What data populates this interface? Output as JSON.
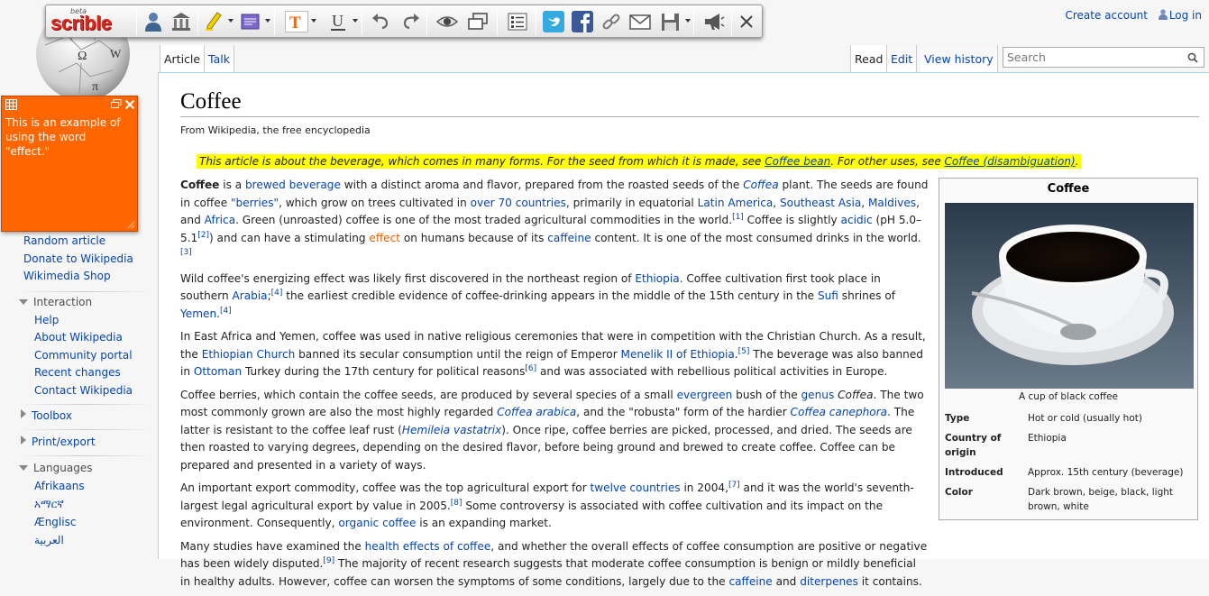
{
  "toolbar": {
    "logo_text": "scrible",
    "logo_badge": "beta",
    "buttons": [
      "my-library",
      "library",
      "highlight",
      "note",
      "text-annotate",
      "underline",
      "undo",
      "redo",
      "view",
      "windows",
      "list",
      "twitter",
      "facebook",
      "link",
      "email",
      "save",
      "announce",
      "close"
    ]
  },
  "note": {
    "text": "This is an example of using the word \"effect.\""
  },
  "personal": {
    "create_account": "Create account",
    "login": "Log in"
  },
  "tabs": {
    "article": "Article",
    "talk": "Talk",
    "read": "Read",
    "edit": "Edit",
    "history": "View history"
  },
  "search": {
    "placeholder": "Search"
  },
  "sidebar": {
    "links_top": [
      "Random article",
      "Donate to Wikipedia",
      "Wikimedia Shop"
    ],
    "interaction": {
      "heading": "Interaction",
      "items": [
        "Help",
        "About Wikipedia",
        "Community portal",
        "Recent changes",
        "Contact Wikipedia"
      ]
    },
    "toolbox": "Toolbox",
    "print_export": "Print/export",
    "languages": {
      "heading": "Languages",
      "items": [
        "Afrikaans",
        "አማርኛ",
        "Ænglisc",
        "العربية"
      ]
    }
  },
  "article": {
    "title": "Coffee",
    "subtitle": "From Wikipedia, the free encyclopedia",
    "hatnote": {
      "pre": "This article is about the beverage, which comes in many forms. For the seed from which it is made, see ",
      "link1": "Coffee bean",
      "mid": ". For other uses, see ",
      "link2": "Coffee (disambiguation)",
      "post": "."
    }
  },
  "infobox": {
    "title": "Coffee",
    "caption": "A cup of black coffee",
    "rows": [
      {
        "key": "Type",
        "value": "Hot or cold (usually hot)"
      },
      {
        "key": "Country of origin",
        "value": "Ethiopia"
      },
      {
        "key": "Introduced",
        "value": "Approx. 15th century (beverage)"
      },
      {
        "key": "Color",
        "value": "Dark brown, beige, black, light brown, white"
      }
    ]
  }
}
